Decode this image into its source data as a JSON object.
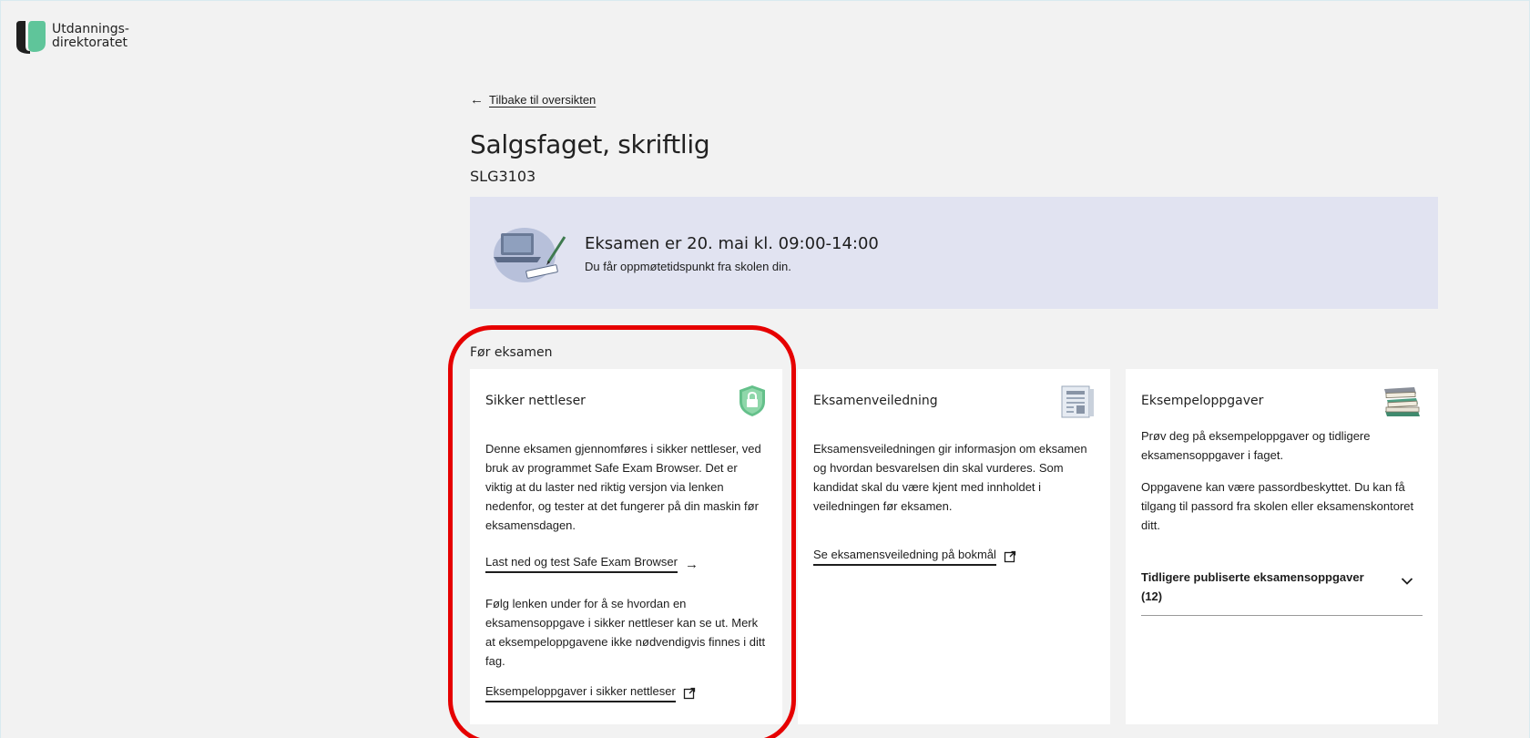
{
  "header": {
    "logo_line1": "Utdannings-",
    "logo_line2": "direktoratet"
  },
  "nav": {
    "back_arrow": "←",
    "back_label": "Tilbake til oversikten"
  },
  "page": {
    "title": "Salgsfaget, skriftlig",
    "code": "SLG3103"
  },
  "banner": {
    "title": "Eksamen er 20. mai kl. 09:00-14:00",
    "subtitle": "Du får oppmøtetidspunkt fra skolen din."
  },
  "section_label": "Før eksamen",
  "cards": [
    {
      "title": "Sikker nettleser",
      "icon": "shield-lock-icon",
      "text1": "Denne eksamen gjennomføres i sikker nettleser, ved bruk av programmet Safe Exam Browser. Det er viktig at du laster ned riktig versjon via lenken nedenfor, og tester at det fungerer på din maskin før eksamensdagen.",
      "link1": "Last ned og test Safe Exam Browser",
      "link1_arrow": "→",
      "text2": "Følg lenken under for å se hvordan en eksamensoppgave i sikker nettleser kan se ut. Merk at eksempeloppgavene ikke nødvendigvis finnes i ditt fag.",
      "link2": "Eksempeloppgaver i sikker nettleser"
    },
    {
      "title": "Eksamenveiledning",
      "icon": "document-icon",
      "text1": "Eksamensveiledningen gir informasjon om eksamen og hvordan besvarelsen din skal vurderes. Som kandidat skal du være kjent med innholdet i veiledningen før eksamen.",
      "link1": "Se eksamensveiledning på bokmål"
    },
    {
      "title": "Eksempeloppgaver",
      "icon": "books-icon",
      "text1": "Prøv deg på eksempeloppgaver og tidligere eksamensoppgaver i faget.",
      "text2": "Oppgavene kan være passordbeskyttet. Du kan få tilgang til passord fra skolen eller eksamenskontoret ditt.",
      "accordion": "Tidligere publiserte eksamensoppgaver (12)"
    }
  ],
  "colors": {
    "background": "#f2f2f2",
    "banner": "#e1e3f1",
    "card": "#ffffff",
    "logo_green": "#5fc59a",
    "shield_green": "#64c08a",
    "highlight_red": "#e60000"
  }
}
